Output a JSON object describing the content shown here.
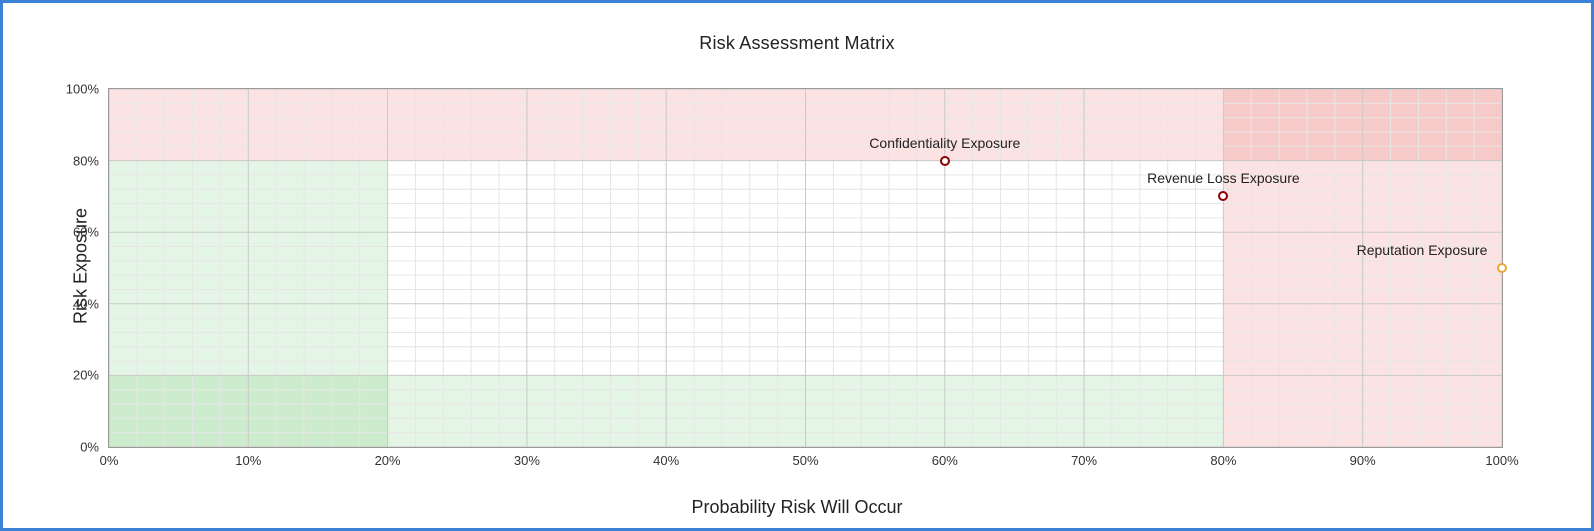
{
  "chart_data": {
    "type": "scatter",
    "title": "Risk Assessment Matrix",
    "xlabel": "Probability Risk Will Occur",
    "ylabel": "Risk Exposure",
    "xlim": [
      0,
      100
    ],
    "ylim": [
      0,
      100
    ],
    "x_tick_step": 10,
    "y_tick_step": 20,
    "tick_suffix": "%",
    "x_minor_step": 2,
    "y_minor_step": 4,
    "series": [
      {
        "name": "Confidentiality Exposure",
        "x": 60,
        "y": 80,
        "color": "#8b0000"
      },
      {
        "name": "Revenue Loss Exposure",
        "x": 80,
        "y": 70,
        "color": "#8b0000"
      },
      {
        "name": "Reputation Exposure",
        "x": 100,
        "y": 50,
        "color": "#e8a838"
      }
    ],
    "zones": [
      {
        "kind": "green",
        "x0": 0,
        "x1": 20,
        "y0": 0,
        "y1": 80
      },
      {
        "kind": "green",
        "x0": 0,
        "x1": 80,
        "y0": 0,
        "y1": 20
      },
      {
        "kind": "red",
        "x0": 0,
        "x1": 100,
        "y0": 80,
        "y1": 100
      },
      {
        "kind": "red",
        "x0": 80,
        "x1": 100,
        "y0": 0,
        "y1": 100
      }
    ]
  }
}
